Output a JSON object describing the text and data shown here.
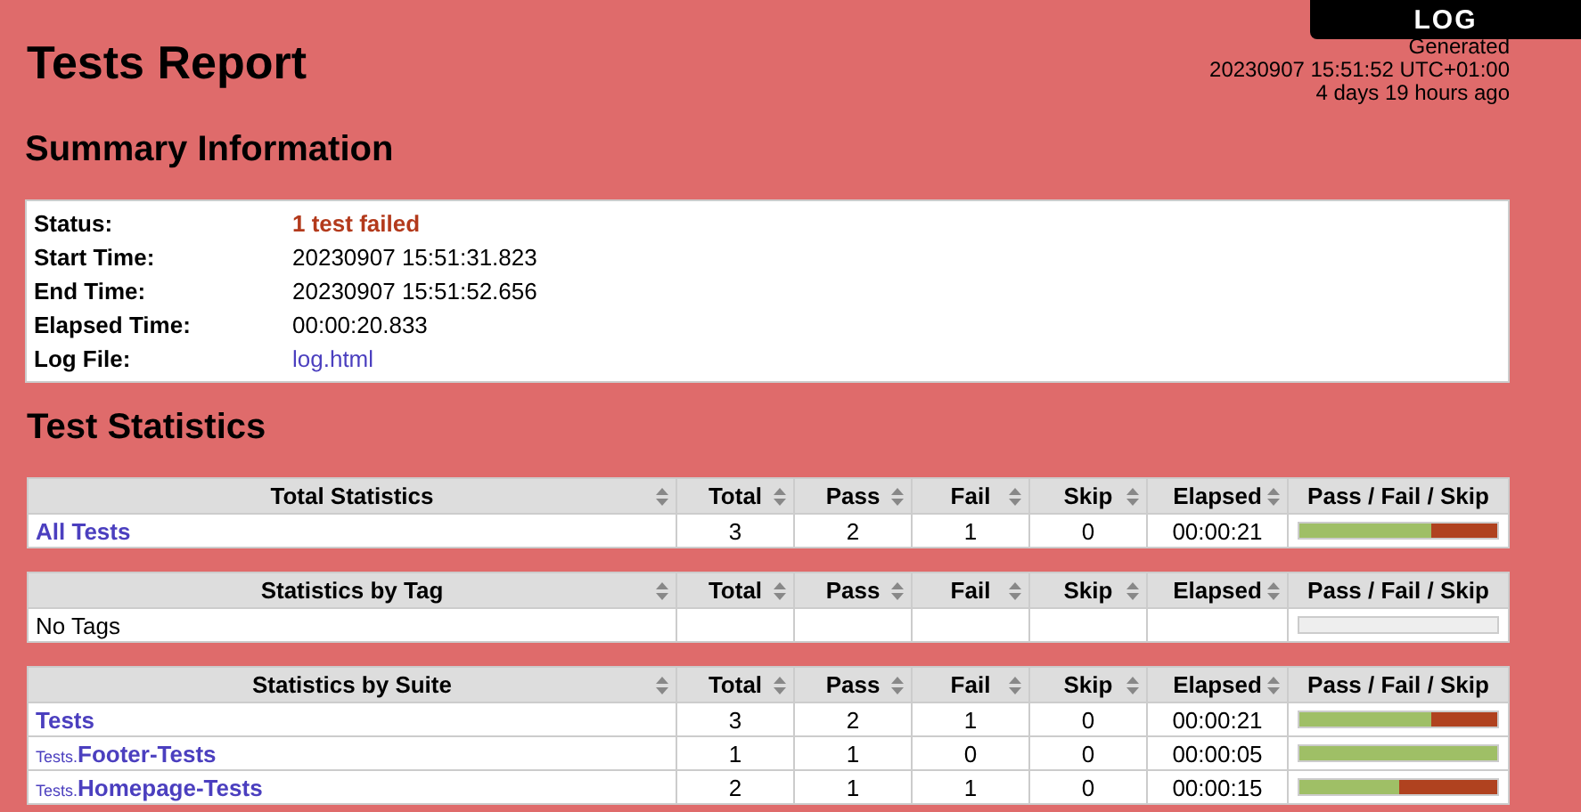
{
  "log_tab": {
    "label": "LOG"
  },
  "header": {
    "title": "Tests Report",
    "generated": "Generated",
    "timestamp": "20230907 15:51:52 UTC+01:00",
    "age": "4 days 19 hours ago"
  },
  "summary": {
    "title": "Summary Information",
    "rows": [
      {
        "label": "Status:",
        "value": "1 test failed",
        "kind": "status"
      },
      {
        "label": "Start Time:",
        "value": "20230907 15:51:31.823",
        "kind": "text"
      },
      {
        "label": "End Time:",
        "value": "20230907 15:51:52.656",
        "kind": "text"
      },
      {
        "label": "Elapsed Time:",
        "value": "00:00:20.833",
        "kind": "text"
      },
      {
        "label": "Log File:",
        "value": "log.html",
        "kind": "link"
      }
    ]
  },
  "statistics": {
    "title": "Test Statistics",
    "tables": [
      {
        "columns": [
          "Total Statistics",
          "Total",
          "Pass",
          "Fail",
          "Skip",
          "Elapsed",
          "Pass / Fail / Skip"
        ],
        "rows": [
          {
            "name": "All Tests",
            "kind": "link",
            "total": "3",
            "pass": "2",
            "fail": "1",
            "skip": "0",
            "elapsed": "00:00:21",
            "bar": [
              {
                "kind": "pass",
                "level": 0.667
              },
              {
                "kind": "fail",
                "level": 0.333
              }
            ]
          }
        ]
      },
      {
        "columns": [
          "Statistics by Tag",
          "Total",
          "Pass",
          "Fail",
          "Skip",
          "Elapsed",
          "Pass / Fail / Skip"
        ],
        "rows": [
          {
            "name": "No Tags",
            "kind": "plain"
          }
        ]
      },
      {
        "columns": [
          "Statistics by Suite",
          "Total",
          "Pass",
          "Fail",
          "Skip",
          "Elapsed",
          "Pass / Fail / Skip"
        ],
        "rows": [
          {
            "name": "Tests",
            "kind": "link",
            "total": "3",
            "pass": "2",
            "fail": "1",
            "skip": "0",
            "elapsed": "00:00:21",
            "bar": [
              {
                "kind": "pass",
                "level": 0.667
              },
              {
                "kind": "fail",
                "level": 0.333
              }
            ]
          },
          {
            "prefix": "Tests.",
            "name": "Footer-Tests",
            "kind": "link",
            "total": "1",
            "pass": "1",
            "fail": "0",
            "skip": "0",
            "elapsed": "00:00:05",
            "bar": [
              {
                "kind": "pass",
                "level": 1
              }
            ]
          },
          {
            "prefix": "Tests.",
            "name": "Homepage-Tests",
            "kind": "link",
            "total": "2",
            "pass": "1",
            "fail": "1",
            "skip": "0",
            "elapsed": "00:00:15",
            "bar": [
              {
                "kind": "pass",
                "level": 0.5
              },
              {
                "kind": "fail",
                "level": 0.5
              }
            ]
          }
        ]
      }
    ]
  }
}
